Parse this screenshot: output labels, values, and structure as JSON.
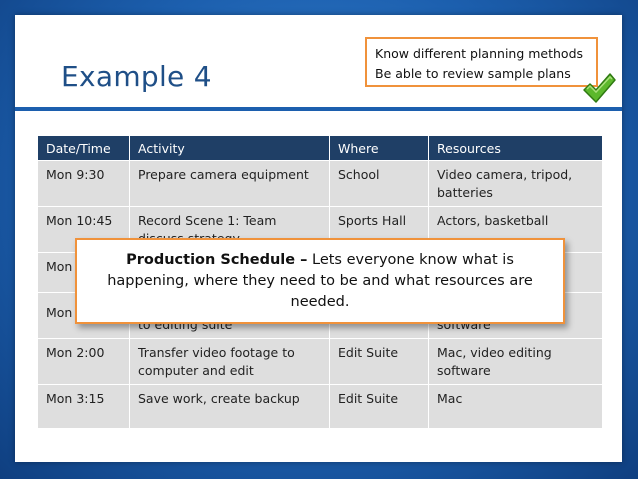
{
  "slide": {
    "title": "Example 4",
    "objectives": [
      "Know different planning methods",
      "Be able to review sample plans"
    ],
    "accent_color": "#1c5fae",
    "callout_border_color": "#f0923b"
  },
  "table": {
    "headers": [
      "Date/Time",
      "Activity",
      "Where",
      "Resources"
    ],
    "rows": [
      {
        "dt": "Mon 9:30",
        "activity": "Prepare camera equipment",
        "where": "School",
        "resources": "Video camera, tripod, batteries"
      },
      {
        "dt": "Mon 10:45",
        "activity": "Record Scene 1: Team discuss strategy",
        "where": "Sports Hall",
        "resources": "Actors, basketball"
      },
      {
        "dt": "Mon",
        "activity": "",
        "where": "",
        "resources": ""
      },
      {
        "dt": "Mon",
        "activity": "to editing suite",
        "where": "",
        "resources": "software"
      },
      {
        "dt": "Mon 2:00",
        "activity": "Transfer video footage to computer and edit",
        "where": "Edit Suite",
        "resources": "Mac, video editing software"
      },
      {
        "dt": "Mon 3:15",
        "activity": "Save work, create backup",
        "where": "Edit Suite",
        "resources": "Mac"
      }
    ]
  },
  "callout": {
    "label": "Production Schedule –",
    "text": " Lets everyone know what is happening, where they need to be and what resources are needed."
  }
}
